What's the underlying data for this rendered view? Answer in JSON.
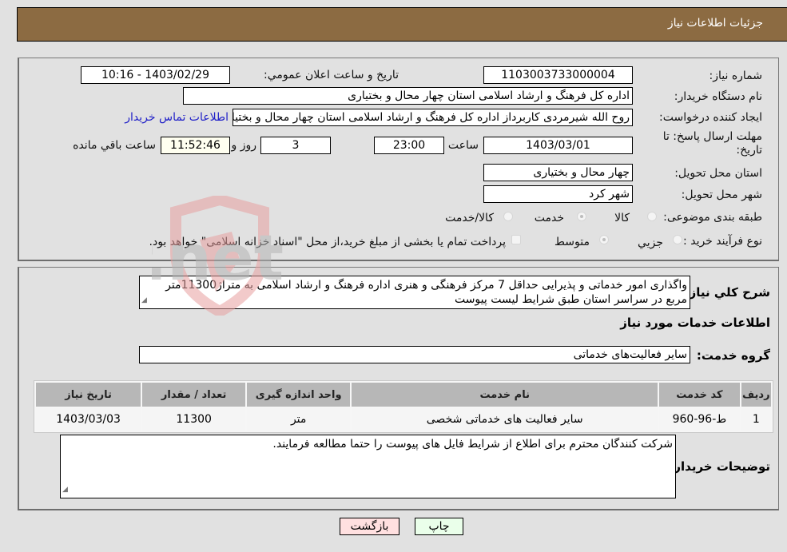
{
  "header": {
    "title": "جزئیات اطلاعات نیاز"
  },
  "details": {
    "need_number_label": "شماره نیاز:",
    "need_number": "1103003733000004",
    "announce_label": "تاریخ و ساعت اعلان عمومي:",
    "announce_value": "1403/02/29 - 10:16",
    "buyer_org_label": "نام دستگاه خریدار:",
    "buyer_org": "اداره کل فرهنگ و ارشاد اسلامی استان چهار محال و بختیاری",
    "creator_label": "ایجاد کننده درخواست:",
    "creator": "روح الله شیرمردی کاربرداز اداره کل فرهنگ و ارشاد اسلامی استان چهار محال و بختیاری",
    "contact_link": "اطلاعات تماس خریدار",
    "deadline_label": "مهلت ارسال پاسخ: تا تاریخ:",
    "deadline_date": "1403/03/01",
    "time_label": "ساعت",
    "deadline_time": "23:00",
    "days_value": "3",
    "days_label": "روز و",
    "remaining_time": "11:52:46",
    "remaining_label": "ساعت باقي مانده",
    "province_label": "استان محل تحویل:",
    "province": "چهار محال و بختیاری",
    "city_label": "شهر محل تحویل:",
    "city": "شهر کرد",
    "category_label": "طبقه بندی موضوعی:",
    "category_options": [
      {
        "label": "کالا",
        "checked": false
      },
      {
        "label": "خدمت",
        "checked": true
      },
      {
        "label": "کالا/خدمت",
        "checked": false
      }
    ],
    "process_label": "نوع فرآیند خرید :",
    "process_options": [
      {
        "label": "جزيي",
        "checked": false
      },
      {
        "label": "متوسط",
        "checked": true
      }
    ],
    "payment_note": "پرداخت تمام یا بخشی از مبلغ خرید،از محل \"اسناد خزانه اسلامی\" خواهد بود."
  },
  "description": {
    "label": "شرح کلي نیاز:",
    "text": "واگذاری امور خدماتی و پذیرایی حداقل 7 مرکز فرهنگی و هنری اداره فرهنگ و ارشاد اسلامی به متراژ11300متر مربع در سراسر استان طبق شرایط لیست پیوست"
  },
  "services": {
    "section_title": "اطلاعات خدمات مورد نیاز",
    "group_label": "گروه خدمت:",
    "group_value": "سایر فعالیت‌های خدماتی",
    "columns": [
      "ردیف",
      "کد خدمت",
      "نام خدمت",
      "واحد اندازه گیری",
      "تعداد / مقدار",
      "تاریخ نیاز"
    ],
    "rows": [
      [
        "1",
        "ط-96-960",
        "سایر فعالیت های خدماتی شخصی",
        "متر",
        "11300",
        "1403/03/03"
      ]
    ]
  },
  "buyer_notes": {
    "label": "توضیحات خریدار:",
    "text": "شرکت کنندگان محترم برای اطلاع از شرایط فایل های پیوست را حتما مطالعه فرمایند."
  },
  "buttons": {
    "print": "چاپ",
    "back": "بازگشت"
  },
  "watermark": {
    "text": "AriaTender.net"
  }
}
